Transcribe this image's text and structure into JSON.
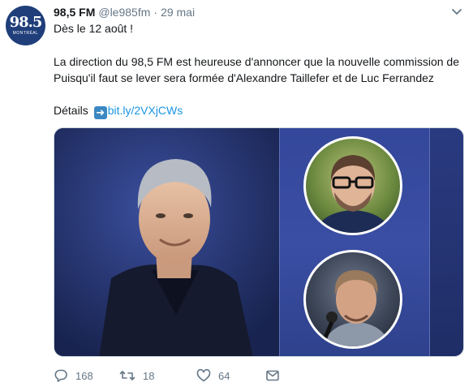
{
  "account": {
    "avatar_text": "98.5",
    "avatar_subtext": "MONTRÉAL",
    "name": "98,5 FM",
    "handle": "@le985fm",
    "separator": "·",
    "date": "29 mai"
  },
  "tweet": {
    "line1": "Dès le 12 août !",
    "line2": "La direction du 98,5 FM est heureuse d'annoncer que la nouvelle commission de Puisqu'il faut se lever sera formée d'Alexandre Taillefer et de Luc Ferrandez",
    "details_label": "Détails",
    "link_text": "bit.ly/2VXjCWs"
  },
  "actions": {
    "replies": "168",
    "retweets": "18",
    "likes": "64"
  },
  "colors": {
    "link": "#1b95e0",
    "muted": "#657786",
    "brand": "#1f3e7a"
  },
  "icons": [
    "caret-down-icon",
    "arrow-right-emoji",
    "reply-icon",
    "retweet-icon",
    "like-icon",
    "message-icon"
  ]
}
